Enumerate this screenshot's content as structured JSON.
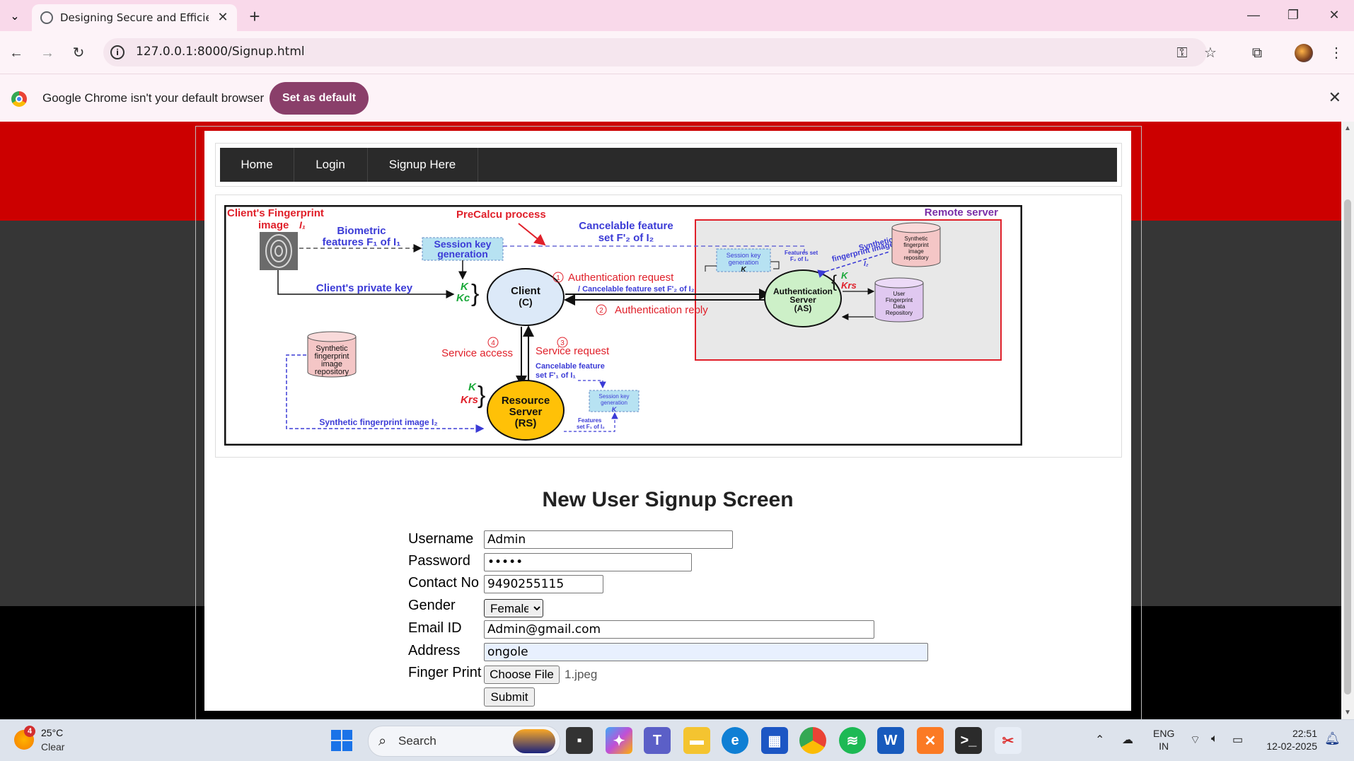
{
  "browser": {
    "tab_title": "Designing Secure and Efficient B",
    "url": "127.0.0.1:8000/Signup.html",
    "infobar_text": "Google Chrome isn't your default browser",
    "set_default_label": "Set as default"
  },
  "nav": {
    "items": [
      {
        "label": "Home"
      },
      {
        "label": "Login"
      },
      {
        "label": "Signup Here"
      }
    ]
  },
  "diagram": {
    "fingerprint_title": "Client's Fingerprint",
    "fingerprint_image": "image",
    "fingerprint_image_sym": "I₁",
    "precalcu": "PreCalcu process",
    "remote_server": "Remote server",
    "biometric_1": "Biometric",
    "biometric_2": "features F₁ of I₁",
    "session_key_1": "Session key",
    "session_key_2": "generation",
    "cancelable_1": "Cancelable feature",
    "cancelable_2": "set F'₂ of I₂",
    "private_key": "Client's private key",
    "k": "K",
    "kc": "Kc",
    "krs": "Krs",
    "client_1": "Client",
    "client_2": "(C)",
    "auth_req_num": "1",
    "auth_req": "Authentication request",
    "auth_req_sub": "/ Cancelable feature set F'₂ of I₂",
    "auth_reply_num": "2",
    "auth_reply": "Authentication reply",
    "as_1": "Authentication",
    "as_2": "Server",
    "as_3": "(AS)",
    "as_session_1": "Session key",
    "as_session_2": "generation",
    "as_features_1": "Features set",
    "as_features_2": "F₂ of I₂",
    "synth_link_1": "Synthetic",
    "synth_link_2": "fingerprint image",
    "synth_link_3": "I₂",
    "synth_repo_1": "Synthetic",
    "synth_repo_2": "fingerprint",
    "synth_repo_3": "image",
    "synth_repo_4": "repository",
    "user_repo_1": "User",
    "user_repo_2": "Fingerprint",
    "user_repo_3": "Data",
    "user_repo_4": "Repository",
    "svc_access_num": "4",
    "svc_access": "Service access",
    "svc_req_num": "3",
    "svc_req": "Service request",
    "rs_cancel_1": "Cancelable feature",
    "rs_cancel_2": "set F'₁ of I₁",
    "rs_1": "Resource",
    "rs_2": "Server",
    "rs_3": "(RS)",
    "rs_session_1": "Session key",
    "rs_session_2": "generation",
    "rs_features_1": "Features",
    "rs_features_2": "set F₁ of I₂",
    "local_repo_1": "Synthetic",
    "local_repo_2": "fingerprint",
    "local_repo_3": "image",
    "local_repo_4": "repository",
    "synth_bottom": "Synthetic fingerprint image I₂"
  },
  "form": {
    "title": "New User Signup Screen",
    "username_label": "Username",
    "username_value": "Admin",
    "password_label": "Password",
    "password_value": "•••••",
    "contact_label": "Contact No",
    "contact_value": "9490255115",
    "gender_label": "Gender",
    "gender_value": "Female",
    "email_label": "Email ID",
    "email_value": "Admin@gmail.com",
    "address_label": "Address",
    "address_value": "ongole",
    "finger_label": "Finger Print",
    "choose_file_label": "Choose File",
    "file_name": "1.jpeg",
    "submit_label": "Submit"
  },
  "taskbar": {
    "weather_badge": "4",
    "weather_temp": "25°C",
    "weather_cond": "Clear",
    "search_label": "Search",
    "lang_1": "ENG",
    "lang_2": "IN",
    "time": "22:51",
    "date": "12-02-2025"
  },
  "colors": {
    "red_band": "#cc0000",
    "dark_band": "#363636",
    "menu_bg": "#2a2a2a",
    "chrome_tab_strip": "#f9d9ea",
    "set_default_button": "#8a3f6a"
  }
}
